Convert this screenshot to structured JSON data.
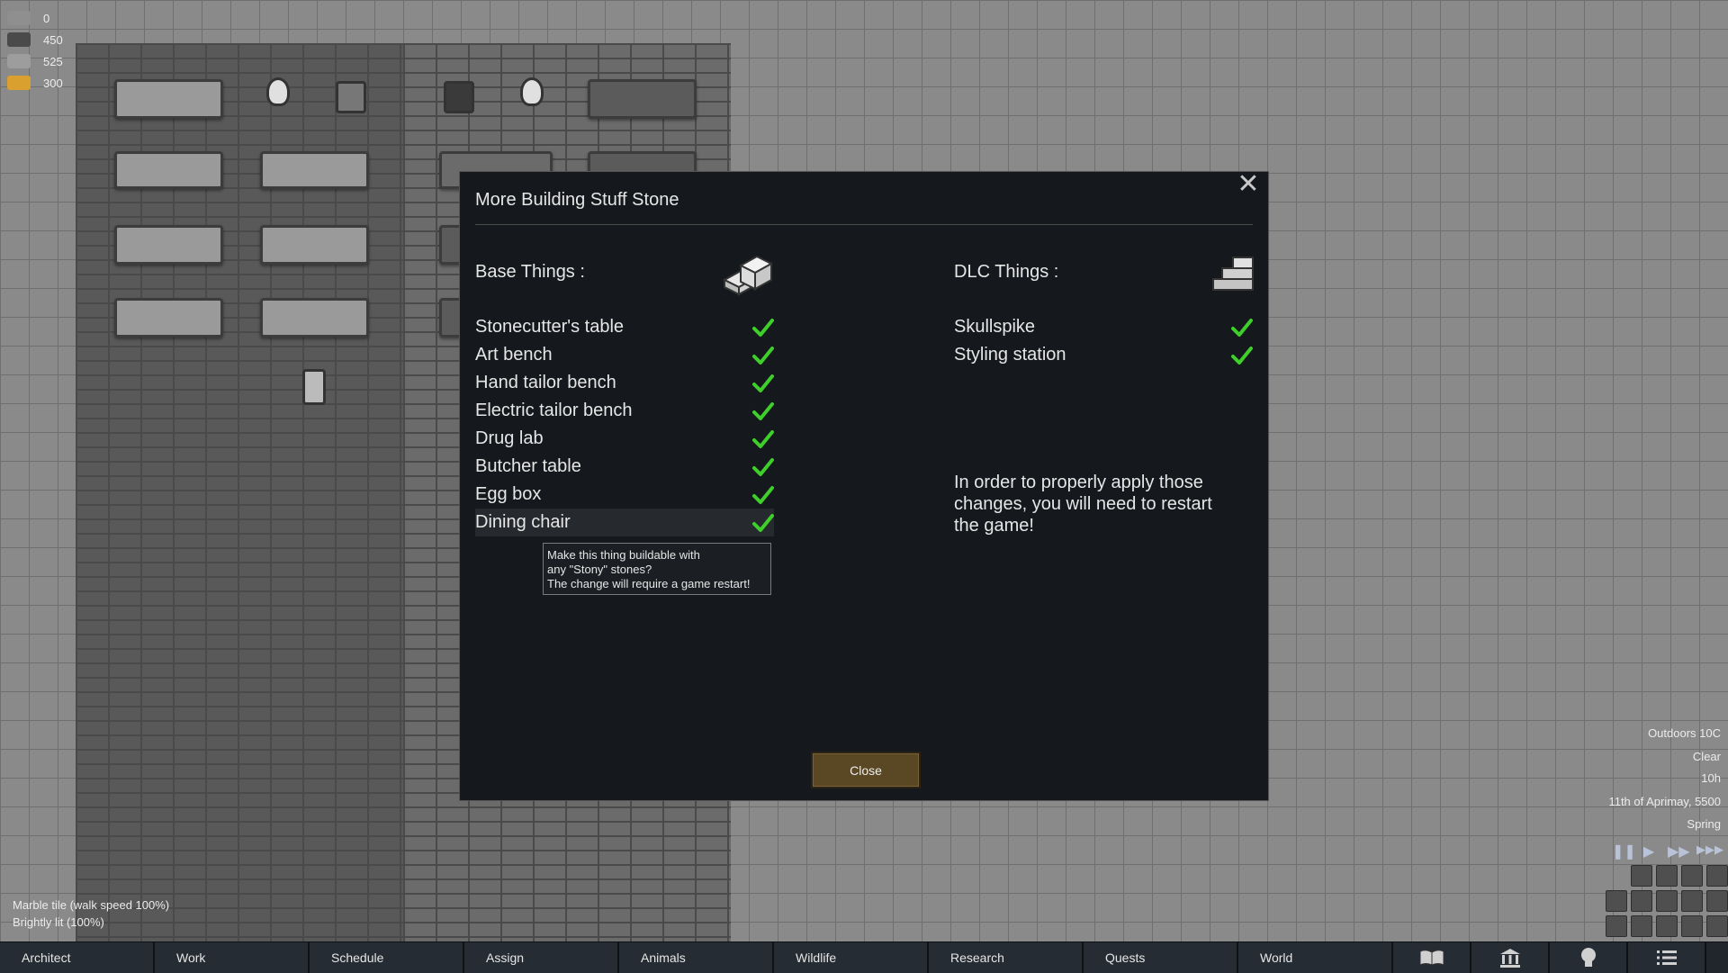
{
  "resources": [
    {
      "icon": "rock-chunk-icon",
      "value": "0"
    },
    {
      "icon": "slate-block-icon",
      "value": "450"
    },
    {
      "icon": "stone-block-icon",
      "value": "525"
    },
    {
      "icon": "gold-icon",
      "value": "300"
    }
  ],
  "dialog": {
    "title": "More Building Stuff Stone",
    "base_heading": "Base Things :",
    "dlc_heading": "DLC Things :",
    "base_items": [
      {
        "label": "Stonecutter's table",
        "checked": true
      },
      {
        "label": "Art bench",
        "checked": true
      },
      {
        "label": "Hand tailor bench",
        "checked": true
      },
      {
        "label": "Electric tailor bench",
        "checked": true
      },
      {
        "label": "Drug lab",
        "checked": true
      },
      {
        "label": "Butcher table",
        "checked": true
      },
      {
        "label": "Egg box",
        "checked": true
      },
      {
        "label": "Dining chair",
        "checked": true
      }
    ],
    "dlc_items": [
      {
        "label": "Skullspike",
        "checked": true
      },
      {
        "label": "Styling station",
        "checked": true
      }
    ],
    "tooltip_lines": [
      "Make this thing buildable with",
      "any \"Stony\" stones?",
      "The change will require a game restart!"
    ],
    "note": "In order to properly apply those changes, you will need to restart the game!",
    "close_label": "Close",
    "check_color": "#3fcf2a"
  },
  "terrain": {
    "tile": "Marble tile (walk speed 100%)",
    "light": "Brightly lit (100%)"
  },
  "weather": {
    "temperature": "Outdoors 10C",
    "condition": "Clear",
    "hour": "10h",
    "date": "11th of Aprimay, 5500",
    "season": "Spring"
  },
  "speed_controls": [
    "pause-icon",
    "play-icon",
    "fast-forward-icon",
    "superfast-icon"
  ],
  "tabs": [
    "Architect",
    "Work",
    "Schedule",
    "Assign",
    "Animals",
    "Wildlife",
    "Research",
    "Quests",
    "World"
  ],
  "tab_icons": [
    "book-icon",
    "ideology-icon",
    "lightbulb-icon",
    "menu-icon"
  ]
}
